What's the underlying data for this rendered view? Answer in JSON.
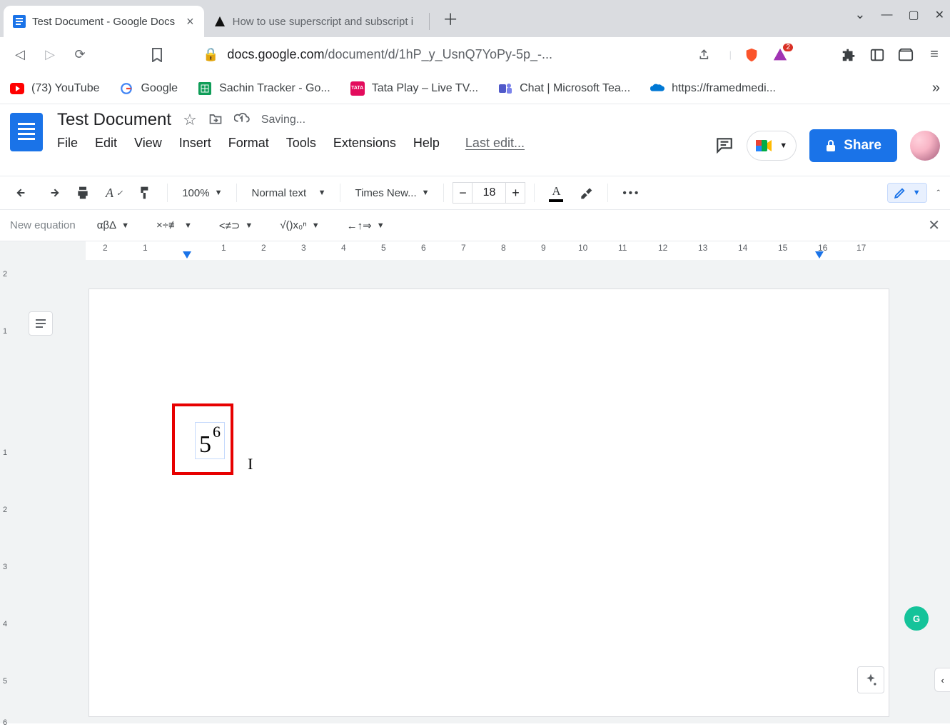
{
  "browser": {
    "tabs": [
      {
        "title": "Test Document - Google Docs",
        "active": true
      },
      {
        "title": "How to use superscript and subscript i",
        "active": false
      }
    ],
    "url_host": "docs.google.com",
    "url_path": "/document/d/1hP_y_UsnQ7YoPy-5p_-...",
    "bookmarks": [
      {
        "label": "(73) YouTube"
      },
      {
        "label": "Google"
      },
      {
        "label": "Sachin Tracker - Go..."
      },
      {
        "label": "Tata Play – Live TV..."
      },
      {
        "label": "Chat | Microsoft Tea..."
      },
      {
        "label": "https://framedmedi..."
      }
    ],
    "bookmarks_overflow": "»",
    "brave_badge": "2"
  },
  "docs": {
    "title": "Test Document",
    "saving": "Saving...",
    "menus": [
      "File",
      "Edit",
      "View",
      "Insert",
      "Format",
      "Tools",
      "Extensions",
      "Help"
    ],
    "last_edit": "Last edit...",
    "share": "Share"
  },
  "toolbar": {
    "zoom": "100%",
    "style": "Normal text",
    "font": "Times New...",
    "font_size": "18"
  },
  "equation": {
    "label": "New equation",
    "groups": [
      "αβΔ",
      "×÷≢",
      "<≠⊃",
      "√()x₀ⁿ",
      "←↑⇒"
    ]
  },
  "ruler": {
    "left": [
      "2",
      "1"
    ],
    "main": [
      "1",
      "2",
      "3",
      "4",
      "5",
      "6",
      "7",
      "8",
      "9",
      "10",
      "11",
      "12",
      "13",
      "14",
      "15",
      "16",
      "17"
    ]
  },
  "vruler": [
    "2",
    "1",
    "1",
    "2",
    "3",
    "4",
    "5",
    "6"
  ],
  "content": {
    "base": "5",
    "exponent": "6"
  },
  "grammarly": "G"
}
